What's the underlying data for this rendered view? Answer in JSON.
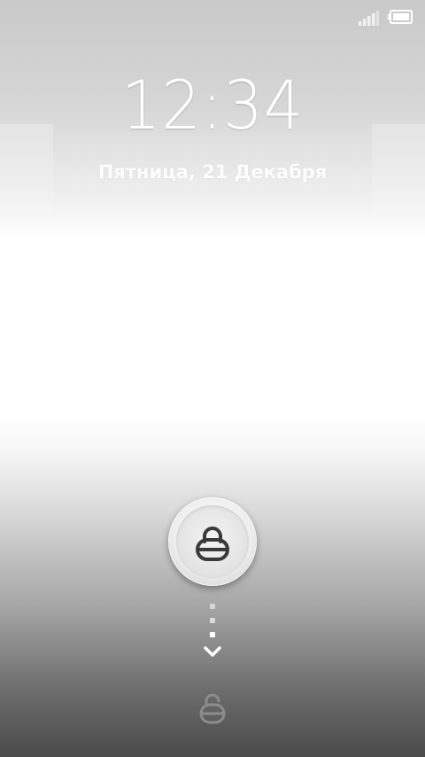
{
  "status_bar": {
    "signal_icon": "signal-strength-icon",
    "battery_icon": "battery-icon"
  },
  "lockscreen": {
    "time": "12:34",
    "date": "Пятница, 21 Декабря"
  },
  "unlock": {
    "lock_icon": "lock-icon",
    "arrow_icon": "chevron-down-icon",
    "target_icon": "unlock-icon"
  },
  "colors": {
    "text": "#ffffff",
    "icon_dark": "#3a3a3a",
    "icon_target": "#8c8c8c"
  }
}
